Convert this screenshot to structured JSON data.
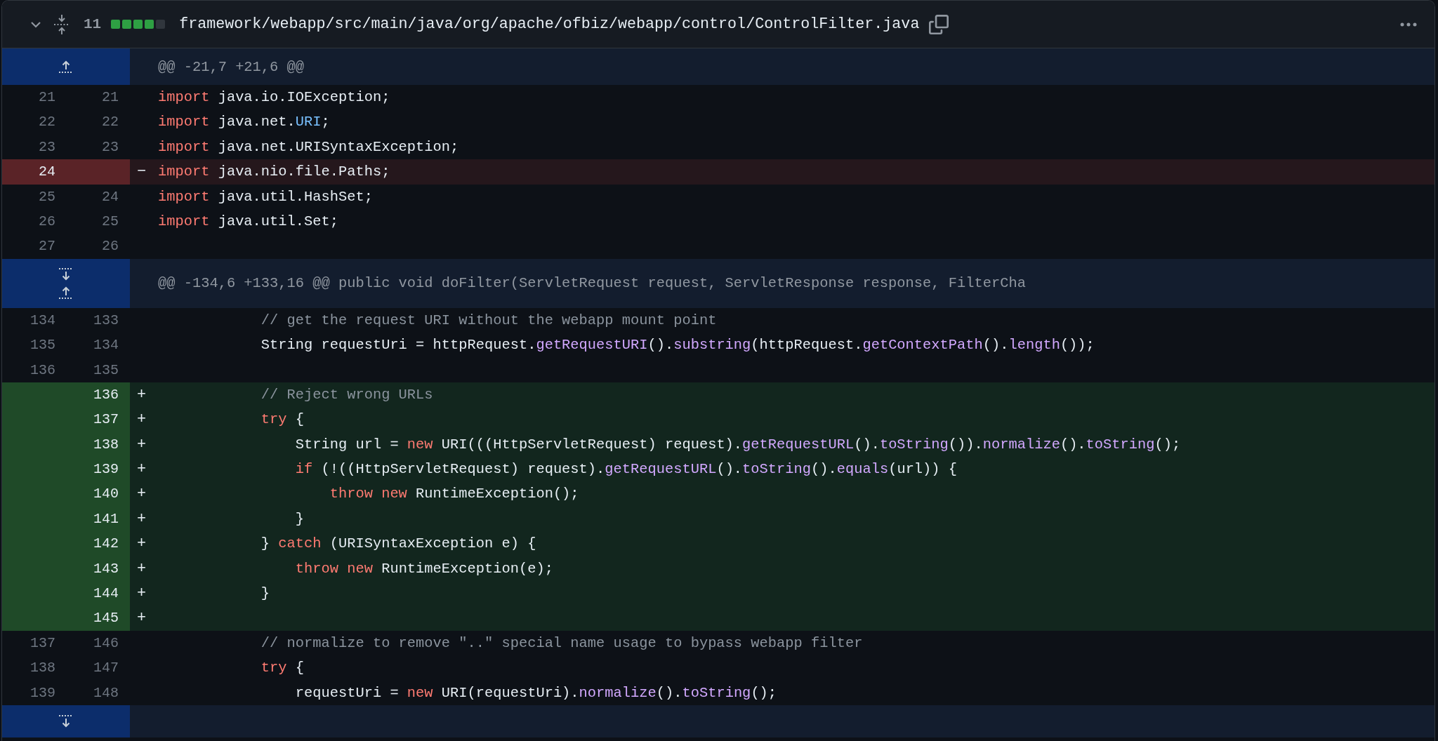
{
  "file": {
    "expanded": true,
    "changes": "11",
    "diffstat": [
      {
        "kind": "added"
      },
      {
        "kind": "added"
      },
      {
        "kind": "added"
      },
      {
        "kind": "added"
      },
      {
        "kind": "neutral"
      }
    ],
    "path": "framework/webapp/src/main/java/org/apache/ofbiz/webapp/control/ControlFilter.java"
  },
  "rows": [
    {
      "kind": "hunk",
      "expand": [
        {
          "kind": "up"
        }
      ],
      "header": "@@ -21,7 +21,6 @@"
    },
    {
      "kind": "context",
      "old": "21",
      "new": "21",
      "tokens": [
        {
          "kind": "kw",
          "text": "import"
        },
        {
          "kind": "pl",
          "text": " java.io.IOException;"
        }
      ]
    },
    {
      "kind": "context",
      "old": "22",
      "new": "22",
      "tokens": [
        {
          "kind": "kw",
          "text": "import"
        },
        {
          "kind": "pl",
          "text": " java.net."
        },
        {
          "kind": "cn",
          "text": "URI"
        },
        {
          "kind": "pl",
          "text": ";"
        }
      ]
    },
    {
      "kind": "context",
      "old": "23",
      "new": "23",
      "tokens": [
        {
          "kind": "kw",
          "text": "import"
        },
        {
          "kind": "pl",
          "text": " java.net.URISyntaxException;"
        }
      ]
    },
    {
      "kind": "deletion",
      "old": "24",
      "marker": "−",
      "tokens": [
        {
          "kind": "kw",
          "text": "import"
        },
        {
          "kind": "pl",
          "text": " java.nio.file.Paths;"
        }
      ]
    },
    {
      "kind": "context",
      "old": "25",
      "new": "24",
      "tokens": [
        {
          "kind": "kw",
          "text": "import"
        },
        {
          "kind": "pl",
          "text": " java.util.HashSet;"
        }
      ]
    },
    {
      "kind": "context",
      "old": "26",
      "new": "25",
      "tokens": [
        {
          "kind": "kw",
          "text": "import"
        },
        {
          "kind": "pl",
          "text": " java.util.Set;"
        }
      ]
    },
    {
      "kind": "context",
      "old": "27",
      "new": "26",
      "tokens": []
    },
    {
      "kind": "hunk",
      "expand": [
        {
          "kind": "down"
        },
        {
          "kind": "up"
        }
      ],
      "header": "@@ -134,6 +133,16 @@ public void doFilter(ServletRequest request, ServletResponse response, FilterCha"
    },
    {
      "kind": "context",
      "old": "134",
      "new": "133",
      "tokens": [
        {
          "kind": "cm",
          "text": "            // get the request URI without the webapp mount point"
        }
      ]
    },
    {
      "kind": "context",
      "old": "135",
      "new": "134",
      "tokens": [
        {
          "kind": "pl",
          "text": "            String requestUri = httpRequest."
        },
        {
          "kind": "fn",
          "text": "getRequestURI"
        },
        {
          "kind": "pl",
          "text": "()."
        },
        {
          "kind": "fn",
          "text": "substring"
        },
        {
          "kind": "pl",
          "text": "(httpRequest."
        },
        {
          "kind": "fn",
          "text": "getContextPath"
        },
        {
          "kind": "pl",
          "text": "()."
        },
        {
          "kind": "fn",
          "text": "length"
        },
        {
          "kind": "pl",
          "text": "());"
        }
      ]
    },
    {
      "kind": "context",
      "old": "136",
      "new": "135",
      "tokens": []
    },
    {
      "kind": "addition",
      "new": "136",
      "marker": "+",
      "tokens": [
        {
          "kind": "cm",
          "text": "            // Reject wrong URLs"
        }
      ]
    },
    {
      "kind": "addition",
      "new": "137",
      "marker": "+",
      "tokens": [
        {
          "kind": "kw",
          "text": "            try"
        },
        {
          "kind": "pl",
          "text": " {"
        }
      ]
    },
    {
      "kind": "addition",
      "new": "138",
      "marker": "+",
      "tokens": [
        {
          "kind": "pl",
          "text": "                String url = "
        },
        {
          "kind": "kw",
          "text": "new"
        },
        {
          "kind": "pl",
          "text": " URI(((HttpServletRequest) request)."
        },
        {
          "kind": "fn",
          "text": "getRequestURL"
        },
        {
          "kind": "pl",
          "text": "()."
        },
        {
          "kind": "fn",
          "text": "toString"
        },
        {
          "kind": "pl",
          "text": "())."
        },
        {
          "kind": "fn",
          "text": "normalize"
        },
        {
          "kind": "pl",
          "text": "()."
        },
        {
          "kind": "fn",
          "text": "toString"
        },
        {
          "kind": "pl",
          "text": "();"
        }
      ]
    },
    {
      "kind": "addition",
      "new": "139",
      "marker": "+",
      "tokens": [
        {
          "kind": "kw",
          "text": "                if"
        },
        {
          "kind": "pl",
          "text": " (!((HttpServletRequest) request)."
        },
        {
          "kind": "fn",
          "text": "getRequestURL"
        },
        {
          "kind": "pl",
          "text": "()."
        },
        {
          "kind": "fn",
          "text": "toString"
        },
        {
          "kind": "pl",
          "text": "()."
        },
        {
          "kind": "fn",
          "text": "equals"
        },
        {
          "kind": "pl",
          "text": "(url)) {"
        }
      ]
    },
    {
      "kind": "addition",
      "new": "140",
      "marker": "+",
      "tokens": [
        {
          "kind": "kw",
          "text": "                    throw new"
        },
        {
          "kind": "pl",
          "text": " RuntimeException();"
        }
      ]
    },
    {
      "kind": "addition",
      "new": "141",
      "marker": "+",
      "tokens": [
        {
          "kind": "pl",
          "text": "                }"
        }
      ]
    },
    {
      "kind": "addition",
      "new": "142",
      "marker": "+",
      "tokens": [
        {
          "kind": "pl",
          "text": "            } "
        },
        {
          "kind": "kw",
          "text": "catch"
        },
        {
          "kind": "pl",
          "text": " (URISyntaxException e) {"
        }
      ]
    },
    {
      "kind": "addition",
      "new": "143",
      "marker": "+",
      "tokens": [
        {
          "kind": "kw",
          "text": "                throw new"
        },
        {
          "kind": "pl",
          "text": " RuntimeException(e);"
        }
      ]
    },
    {
      "kind": "addition",
      "new": "144",
      "marker": "+",
      "tokens": [
        {
          "kind": "pl",
          "text": "            }"
        }
      ]
    },
    {
      "kind": "addition",
      "new": "145",
      "marker": "+",
      "tokens": []
    },
    {
      "kind": "context",
      "old": "137",
      "new": "146",
      "tokens": [
        {
          "kind": "cm",
          "text": "            // normalize to remove \"..\" special name usage to bypass webapp filter"
        }
      ]
    },
    {
      "kind": "context",
      "old": "138",
      "new": "147",
      "tokens": [
        {
          "kind": "kw",
          "text": "            try"
        },
        {
          "kind": "pl",
          "text": " {"
        }
      ]
    },
    {
      "kind": "context",
      "old": "139",
      "new": "148",
      "tokens": [
        {
          "kind": "pl",
          "text": "                requestUri = "
        },
        {
          "kind": "kw",
          "text": "new"
        },
        {
          "kind": "pl",
          "text": " URI(requestUri)."
        },
        {
          "kind": "fn",
          "text": "normalize"
        },
        {
          "kind": "pl",
          "text": "()."
        },
        {
          "kind": "fn",
          "text": "toString"
        },
        {
          "kind": "pl",
          "text": "();"
        }
      ]
    },
    {
      "kind": "hunk",
      "expand": [
        {
          "kind": "down"
        }
      ]
    }
  ]
}
